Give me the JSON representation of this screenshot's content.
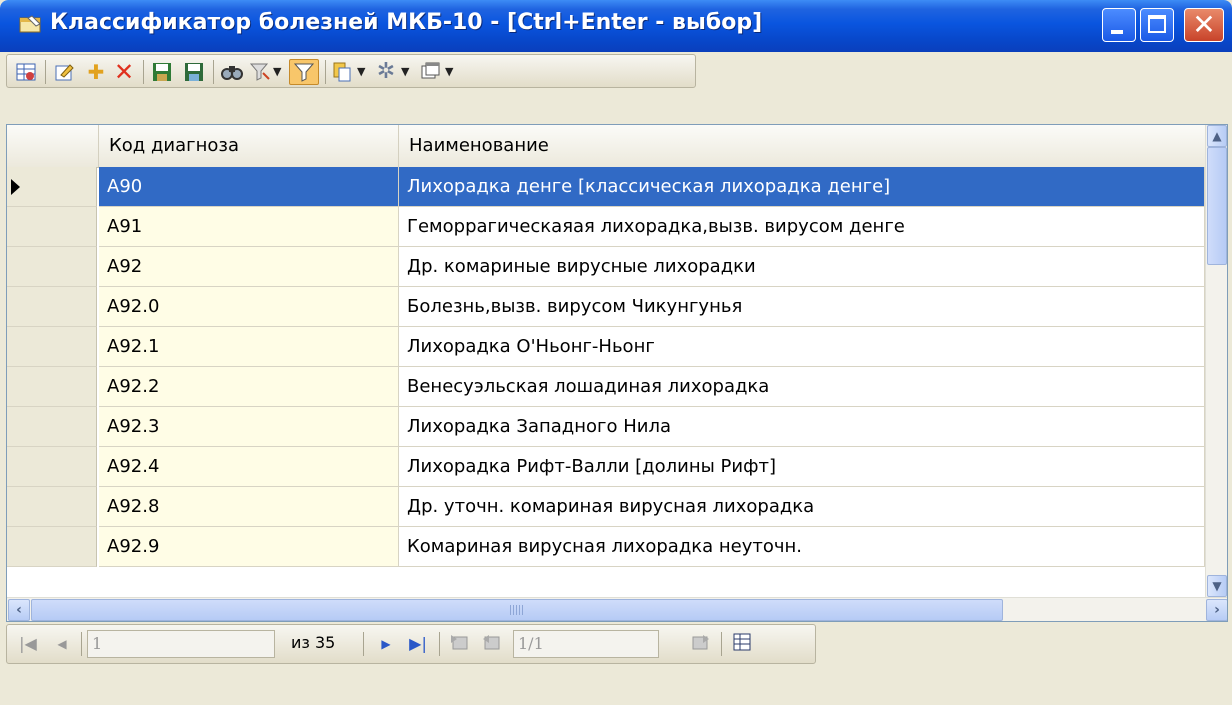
{
  "window": {
    "title": "Классификатор болезней МКБ-10 - [Ctrl+Enter - выбор]"
  },
  "toolbar": {
    "icons": [
      "grid-settings-icon",
      "edit-icon",
      "add-icon",
      "delete-icon",
      "save-icon",
      "save-all-icon",
      "find-icon",
      "filter-dropdown-icon",
      "filter-icon",
      "copy-dropdown-icon",
      "gear-dropdown-icon",
      "window-dropdown-icon"
    ],
    "filter_active": true
  },
  "grid": {
    "columns": [
      "Код диагноза",
      "Наименование"
    ],
    "rows": [
      {
        "code": "A90",
        "name": "Лихорадка денге [классическая лихорадка денге]",
        "selected": true
      },
      {
        "code": "A91",
        "name": "Геморрагическаяая лихорадка,вызв. вирусом денге",
        "selected": false
      },
      {
        "code": "A92",
        "name": "Др. комариные вирусные лихорадки",
        "selected": false
      },
      {
        "code": "A92.0",
        "name": "Болезнь,вызв. вирусом Чикунгунья",
        "selected": false
      },
      {
        "code": "A92.1",
        "name": "Лихорадка О'Ньонг-Ньонг",
        "selected": false
      },
      {
        "code": "A92.2",
        "name": "Венесуэльская лошадиная лихорадка",
        "selected": false
      },
      {
        "code": "A92.3",
        "name": "Лихорадка Западного Нила",
        "selected": false
      },
      {
        "code": "A92.4",
        "name": "Лихорадка Рифт-Валли [долины Рифт]",
        "selected": false
      },
      {
        "code": "A92.8",
        "name": "Др. уточн. комариная вирусная лихорадка",
        "selected": false
      },
      {
        "code": "A92.9",
        "name": "Комариная вирусная лихорадка неуточн.",
        "selected": false
      }
    ]
  },
  "navigator": {
    "page_value": "1",
    "page_total": "из 35",
    "record_value": "1/1"
  },
  "colors": {
    "titlebar": "#0a55df",
    "selection": "#316ac5",
    "code_column_bg": "#fffde6"
  }
}
